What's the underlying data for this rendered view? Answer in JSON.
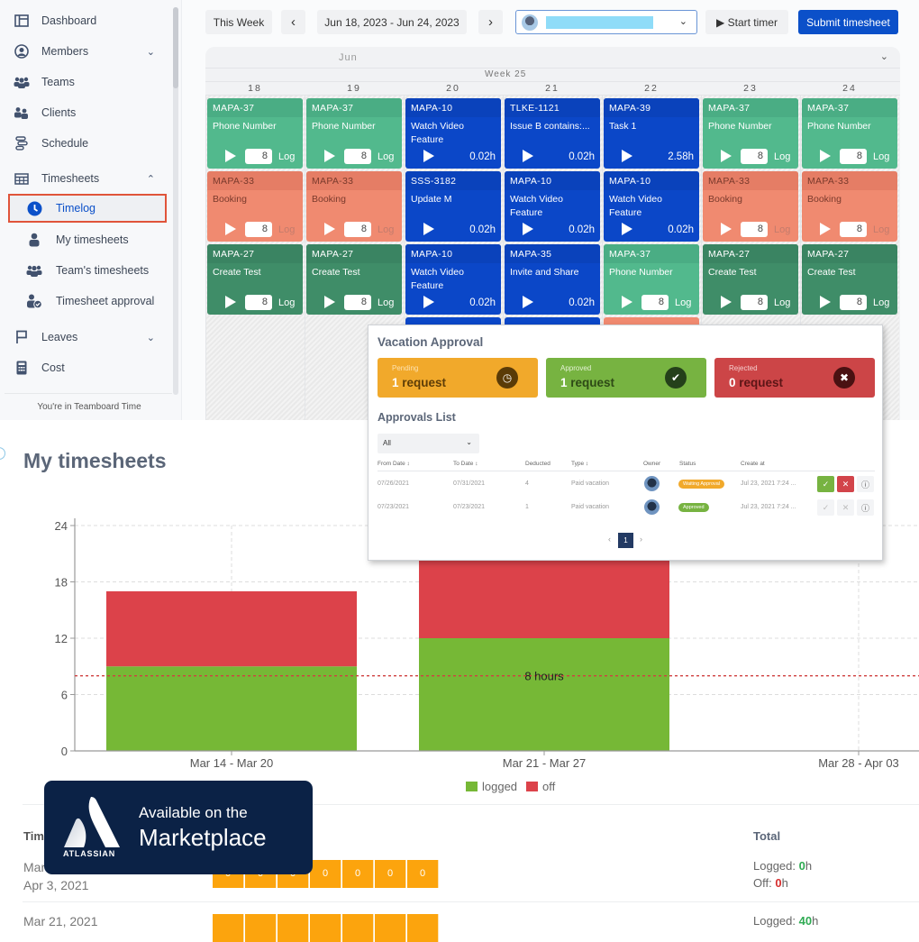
{
  "sidebar": {
    "items": [
      {
        "label": "Dashboard",
        "icon": "dashboard-icon"
      },
      {
        "label": "Members",
        "icon": "member-icon",
        "chevron": "down"
      },
      {
        "label": "Teams",
        "icon": "teams-icon"
      },
      {
        "label": "Clients",
        "icon": "clients-icon"
      },
      {
        "label": "Schedule",
        "icon": "schedule-icon"
      },
      {
        "label": "Timesheets",
        "icon": "grid-icon",
        "chevron": "up"
      },
      {
        "label": "Timelog",
        "icon": "clock-icon",
        "active": true
      },
      {
        "label": "My timesheets",
        "icon": "person-icon"
      },
      {
        "label": "Team's timesheets",
        "icon": "team-icon"
      },
      {
        "label": "Timesheet approval",
        "icon": "approval-icon"
      },
      {
        "label": "Leaves",
        "icon": "flag-icon",
        "chevron": "down"
      },
      {
        "label": "Cost",
        "icon": "calculator-icon"
      }
    ],
    "footer": "You're in Teamboard Time",
    "chev_down": "⌄",
    "chev_up": "⌃"
  },
  "toolbar": {
    "this_week": "This Week",
    "prev": "‹",
    "date_range": "Jun 18, 2023 - Jun 24, 2023",
    "next": "›",
    "user_chevron": "⌄",
    "start_timer": "▶ Start timer",
    "submit": "Submit timesheet"
  },
  "calendar": {
    "month": "Jun",
    "week": "Week 25",
    "collapse": "⌄",
    "days": [
      "18",
      "19",
      "20",
      "21",
      "22",
      "23",
      "24"
    ],
    "log_label": "Log",
    "cards": [
      [
        {
          "key": "MAPA-37",
          "title": "Phone Number",
          "color": "green",
          "value": "8"
        },
        {
          "key": "MAPA-33",
          "title": "Booking",
          "color": "salmon",
          "value": "8"
        },
        {
          "key": "MAPA-27",
          "title": "Create Test",
          "color": "dgreen",
          "value": "8"
        }
      ],
      [
        {
          "key": "MAPA-37",
          "title": "Phone Number",
          "color": "green",
          "value": "8"
        },
        {
          "key": "MAPA-33",
          "title": "Booking",
          "color": "salmon",
          "value": "8"
        },
        {
          "key": "MAPA-27",
          "title": "Create Test",
          "color": "dgreen",
          "value": "8"
        }
      ],
      [
        {
          "key": "MAPA-10",
          "title": "Watch Video Feature",
          "color": "blue",
          "hours": "0.02h"
        },
        {
          "key": "SSS-3182",
          "title": "Update M",
          "color": "blue",
          "hours": "0.02h"
        },
        {
          "key": "MAPA-10",
          "title": "Watch Video Feature",
          "color": "blue",
          "hours": "0.02h"
        }
      ],
      [
        {
          "key": "TLKE-1121",
          "title": "Issue B contains:...",
          "color": "blue",
          "hours": "0.02h"
        },
        {
          "key": "MAPA-10",
          "title": "Watch Video Feature",
          "color": "blue",
          "hours": "0.02h"
        },
        {
          "key": "MAPA-35",
          "title": "Invite and Share",
          "color": "blue",
          "hours": "0.02h"
        }
      ],
      [
        {
          "key": "MAPA-39",
          "title": "Task 1",
          "color": "blue",
          "hours": "2.58h"
        },
        {
          "key": "MAPA-10",
          "title": "Watch Video Feature",
          "color": "blue",
          "hours": "0.02h"
        },
        {
          "key": "MAPA-37",
          "title": "Phone Number",
          "color": "green",
          "value": "8"
        }
      ],
      [
        {
          "key": "MAPA-37",
          "title": "Phone Number",
          "color": "green",
          "value": "8"
        },
        {
          "key": "MAPA-33",
          "title": "Booking",
          "color": "salmon",
          "value": "8"
        },
        {
          "key": "MAPA-27",
          "title": "Create Test",
          "color": "dgreen",
          "value": "8"
        }
      ],
      [
        {
          "key": "MAPA-37",
          "title": "Phone Number",
          "color": "green",
          "value": "8"
        },
        {
          "key": "MAPA-33",
          "title": "Booking",
          "color": "salmon",
          "value": "8"
        },
        {
          "key": "MAPA-27",
          "title": "Create Test",
          "color": "dgreen",
          "value": "8"
        }
      ]
    ],
    "overflow_cards": [
      {
        "day_index": 2,
        "color": "blue"
      },
      {
        "day_index": 3,
        "color": "blue"
      },
      {
        "day_index": 4,
        "color": "salmon"
      }
    ]
  },
  "vacation": {
    "title": "Vacation Approval",
    "stats": [
      {
        "label": "Pending",
        "count": "1",
        "unit": " request",
        "icon": "clock-icon",
        "glyph": "◷"
      },
      {
        "label": "Approved",
        "count": "1",
        "unit": " request",
        "icon": "check-icon",
        "glyph": "✔"
      },
      {
        "label": "Rejected",
        "count": "0",
        "unit": " request",
        "icon": "x-icon",
        "glyph": "✖"
      }
    ],
    "list_title": "Approvals List",
    "filter": "All",
    "filter_chevron": "⌄",
    "columns": [
      "From Date ↕",
      "To Date ↕",
      "Deducted",
      "Type ↕",
      "Owner",
      "Status",
      "Create at"
    ],
    "rows": [
      {
        "from": "07/26/2021",
        "to": "07/31/2021",
        "deducted": "4",
        "type": "Paid vacation",
        "status": "Waiting Approval",
        "status_color": "#f1a92b",
        "created": "Jul 23, 2021 7:24 ...",
        "actionable": true
      },
      {
        "from": "07/23/2021",
        "to": "07/23/2021",
        "deducted": "1",
        "type": "Paid vacation",
        "status": "Approved",
        "status_color": "#77b341",
        "created": "Jul 23, 2021 7:24 ...",
        "actionable": false
      }
    ],
    "approve_glyph": "✓",
    "reject_glyph": "✕",
    "info_glyph": "ⓘ",
    "pager": {
      "prev": "‹",
      "page": "1",
      "next": "›"
    }
  },
  "my_timesheets": {
    "title": "My timesheets",
    "table": {
      "col_time": "Tim",
      "col_total": "Total",
      "rows": [
        {
          "date_line1": "Mar",
          "date_line2": "Apr 3, 2021",
          "hours": [
            "0",
            "0",
            "0",
            "0",
            "0",
            "0",
            "0"
          ],
          "logged_label": "Logged: ",
          "logged": "0",
          "off_label": "Off: ",
          "off": "0",
          "unit": "h"
        },
        {
          "date_line1": "Mar 21, 2021",
          "logged_label": "Logged: ",
          "logged": "40",
          "unit": "h"
        }
      ]
    }
  },
  "chart_data": {
    "type": "bar",
    "stacked": true,
    "categories": [
      "Mar 14 - Mar 20",
      "Mar 21 - Mar 27",
      "Mar 28 - Apr 03"
    ],
    "series": [
      {
        "name": "logged",
        "color": "#76b836",
        "values": [
          9,
          12,
          0
        ]
      },
      {
        "name": "off",
        "color": "#dc424a",
        "values": [
          8,
          10,
          0
        ]
      }
    ],
    "ylim": [
      0,
      24
    ],
    "yticks": [
      0,
      6,
      12,
      18,
      24
    ],
    "reference_line": {
      "value": 8,
      "label": "8 hours",
      "color": "#d04040"
    },
    "grid": true,
    "legend": "bottom-center",
    "title": "",
    "xlabel": "",
    "ylabel": ""
  },
  "marketplace": {
    "brand": "ATLASSIAN",
    "line1": "Available on the",
    "line2": "Marketplace"
  }
}
